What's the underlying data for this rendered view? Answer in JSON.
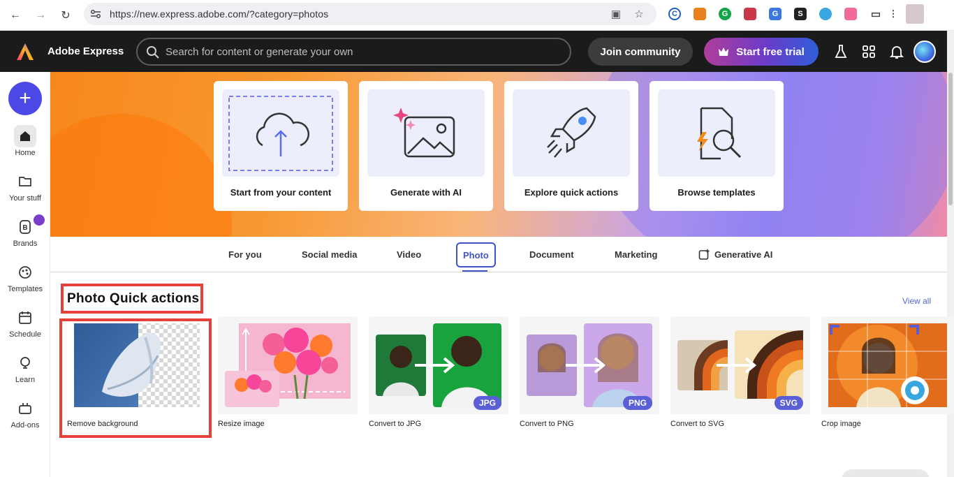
{
  "browser": {
    "url": "https://new.express.adobe.com/?category=photos"
  },
  "header": {
    "brand": "Adobe Express",
    "search_placeholder": "Search for content or generate your own",
    "join_label": "Join community",
    "trial_label": "Start free trial"
  },
  "sidebar": {
    "items": [
      {
        "label": "Home",
        "icon": "home-icon"
      },
      {
        "label": "Your stuff",
        "icon": "folder-icon"
      },
      {
        "label": "Brands",
        "icon": "brand-icon"
      },
      {
        "label": "Templates",
        "icon": "templates-icon"
      },
      {
        "label": "Schedule",
        "icon": "calendar-icon"
      },
      {
        "label": "Learn",
        "icon": "lightbulb-icon"
      },
      {
        "label": "Add-ons",
        "icon": "addons-icon"
      }
    ]
  },
  "hero": {
    "cards": [
      {
        "label": "Start from your content",
        "icon": "upload-cloud-icon"
      },
      {
        "label": "Generate with AI",
        "icon": "ai-image-icon"
      },
      {
        "label": "Explore quick actions",
        "icon": "rocket-icon"
      },
      {
        "label": "Browse templates",
        "icon": "search-document-icon"
      }
    ]
  },
  "tabs": [
    {
      "label": "For you"
    },
    {
      "label": "Social media"
    },
    {
      "label": "Video"
    },
    {
      "label": "Photo",
      "active": true
    },
    {
      "label": "Document"
    },
    {
      "label": "Marketing"
    },
    {
      "label": "Generative AI"
    }
  ],
  "section": {
    "title": "Photo Quick actions",
    "view_all": "View all",
    "actions": [
      {
        "label": "Remove background"
      },
      {
        "label": "Resize image"
      },
      {
        "label": "Convert to JPG",
        "badge": "JPG"
      },
      {
        "label": "Convert to PNG",
        "badge": "PNG"
      },
      {
        "label": "Convert to SVG",
        "badge": "SVG"
      },
      {
        "label": "Crop image"
      }
    ]
  },
  "colors": {
    "accent": "#4b48e6",
    "highlight": "#e6403a",
    "active_tab": "#3d56c5"
  }
}
